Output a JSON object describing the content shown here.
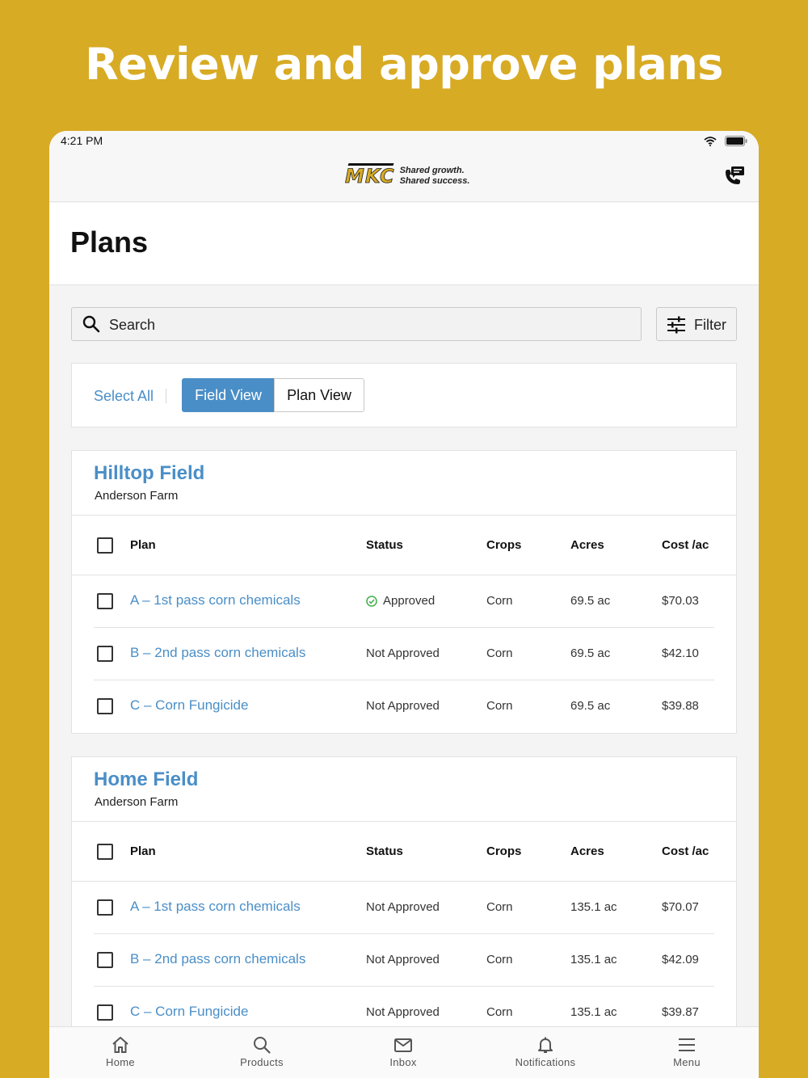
{
  "headline": "Review and approve plans",
  "status_bar": {
    "time": "4:21 PM"
  },
  "header": {
    "logo_text": "MKC",
    "logo_tagline_1": "Shared growth.",
    "logo_tagline_2": "Shared success."
  },
  "page_title": "Plans",
  "search": {
    "label": "Search"
  },
  "filter": {
    "label": "Filter"
  },
  "view": {
    "select_all": "Select All",
    "field_view": "Field View",
    "plan_view": "Plan View",
    "active": "Field View"
  },
  "columns": {
    "plan": "Plan",
    "status": "Status",
    "crops": "Crops",
    "acres": "Acres",
    "cost": "Cost /ac"
  },
  "fields": [
    {
      "name": "Hilltop Field",
      "farm": "Anderson Farm",
      "plans": [
        {
          "name": "A – 1st pass corn chemicals",
          "status": "Approved",
          "crop": "Corn",
          "acres": "69.5 ac",
          "cost": "$70.03"
        },
        {
          "name": "B – 2nd pass corn chemicals",
          "status": "Not Approved",
          "crop": "Corn",
          "acres": "69.5 ac",
          "cost": "$42.10"
        },
        {
          "name": "C – Corn Fungicide",
          "status": "Not Approved",
          "crop": "Corn",
          "acres": "69.5 ac",
          "cost": "$39.88"
        }
      ]
    },
    {
      "name": "Home Field",
      "farm": "Anderson Farm",
      "plans": [
        {
          "name": "A – 1st pass corn chemicals",
          "status": "Not Approved",
          "crop": "Corn",
          "acres": "135.1 ac",
          "cost": "$70.07"
        },
        {
          "name": "B – 2nd pass corn chemicals",
          "status": "Not Approved",
          "crop": "Corn",
          "acres": "135.1 ac",
          "cost": "$42.09"
        },
        {
          "name": "C – Corn Fungicide",
          "status": "Not Approved",
          "crop": "Corn",
          "acres": "135.1 ac",
          "cost": "$39.87"
        }
      ]
    }
  ],
  "tabs": [
    {
      "label": "Home",
      "icon": "home-icon"
    },
    {
      "label": "Products",
      "icon": "search-icon"
    },
    {
      "label": "Inbox",
      "icon": "mail-icon"
    },
    {
      "label": "Notifications",
      "icon": "bell-icon"
    },
    {
      "label": "Menu",
      "icon": "menu-icon"
    }
  ],
  "colors": {
    "background": "#d8ab25",
    "accent": "#4a8ec7",
    "approved": "#3fae49"
  }
}
